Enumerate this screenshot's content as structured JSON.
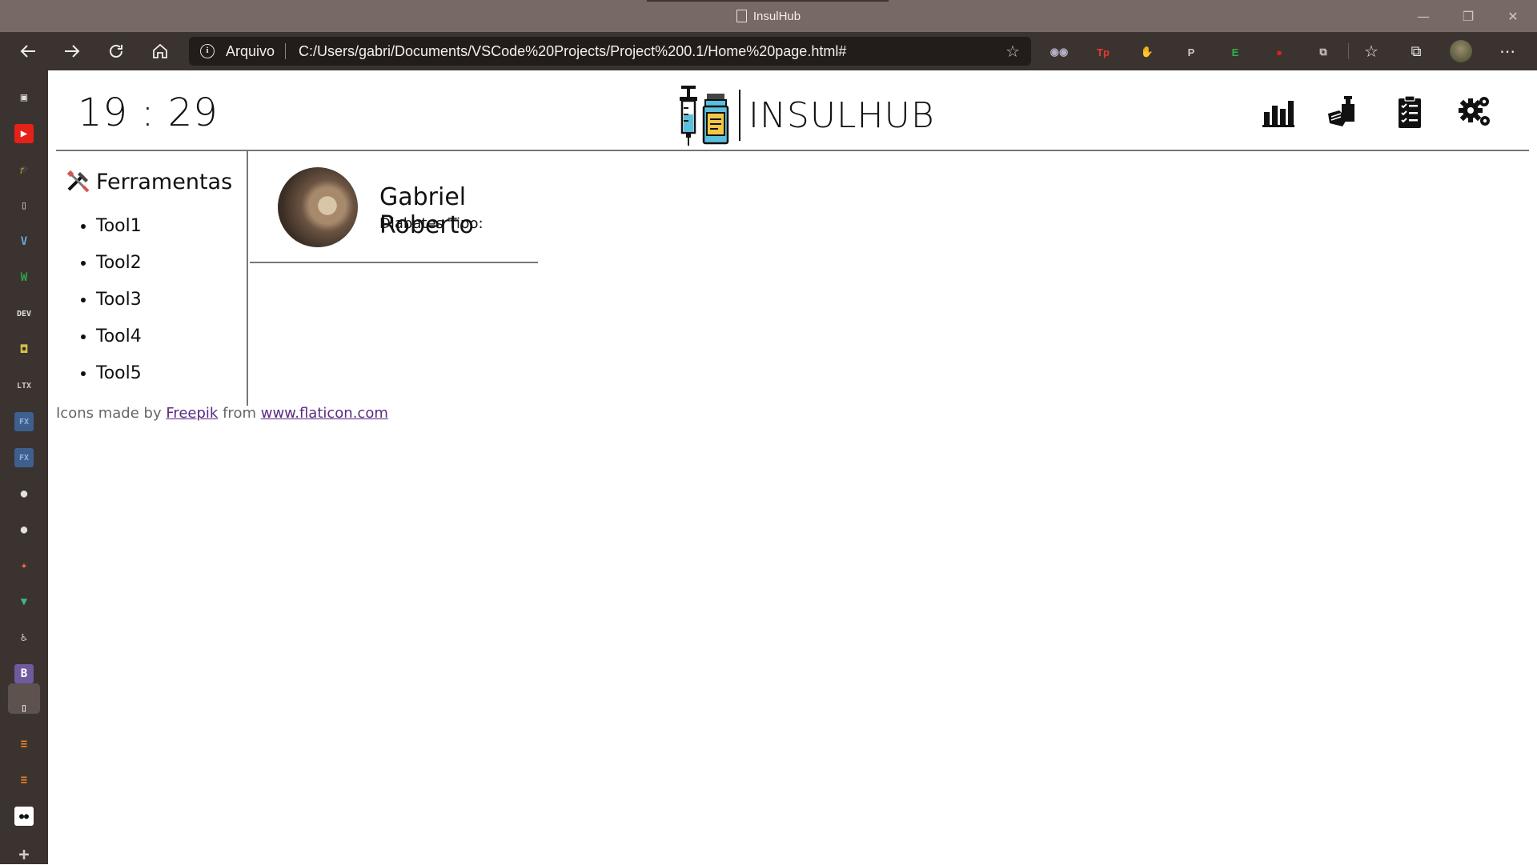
{
  "window": {
    "title": "InsulHub",
    "controls": [
      "—",
      "❐",
      "✕"
    ]
  },
  "toolbar": {
    "back_icon": "arrow-left-icon",
    "forward_icon": "arrow-right-icon",
    "refresh_icon": "refresh-icon",
    "home_icon": "home-icon",
    "address_prefix": "Arquivo",
    "url": "C:/Users/gabri/Documents/VSCode%20Projects/Project%200.1/Home%20page.html#",
    "extensions": [
      {
        "name": "ext-eyes",
        "label": "◉◉",
        "color": "#b5b0c8"
      },
      {
        "name": "ext-tp",
        "label": "Tp",
        "color": "#e53b2c"
      },
      {
        "name": "ext-hand",
        "label": "✋",
        "color": "#e0201a"
      },
      {
        "name": "ext-pinterest",
        "label": "P",
        "color": "#cfc8c5"
      },
      {
        "name": "ext-evernote",
        "label": "E",
        "color": "#2fb344"
      },
      {
        "name": "ext-record",
        "label": "●",
        "color": "#e0201a"
      },
      {
        "name": "ext-puzzle",
        "label": "⧉",
        "color": "#cfc8c5"
      }
    ]
  },
  "vertical_tabs": [
    {
      "name": "tab-actions",
      "label": "▣",
      "color": "#e6e0dd",
      "bg": "transparent"
    },
    {
      "name": "tab-youtube",
      "label": "▶",
      "color": "#ffffff",
      "bg": "#e62117"
    },
    {
      "name": "tab-school",
      "label": "🎓",
      "color": "#cfc8c5",
      "bg": "transparent"
    },
    {
      "name": "tab-file-1",
      "label": "▯",
      "color": "#cfc8c5",
      "bg": "transparent"
    },
    {
      "name": "tab-vuetify",
      "label": "V",
      "color": "#6aa4d8",
      "bg": "transparent"
    },
    {
      "name": "tab-w",
      "label": "W",
      "color": "#2fa34a",
      "bg": "transparent"
    },
    {
      "name": "tab-dev",
      "label": "DEV",
      "color": "#e6e0dd",
      "bg": "transparent"
    },
    {
      "name": "tab-yellow",
      "label": "◘",
      "color": "#d8c24a",
      "bg": "transparent"
    },
    {
      "name": "tab-ltx",
      "label": "LTX",
      "color": "#cfc8c5",
      "bg": "transparent"
    },
    {
      "name": "tab-fx-1",
      "label": "FX",
      "color": "#8fb4e0",
      "bg": "#3f5f8f"
    },
    {
      "name": "tab-fx-2",
      "label": "FX",
      "color": "#8fb4e0",
      "bg": "#3f5f8f"
    },
    {
      "name": "tab-github-1",
      "label": "●",
      "color": "#e6e0dd",
      "bg": "transparent"
    },
    {
      "name": "tab-github-2",
      "label": "●",
      "color": "#e6e0dd",
      "bg": "transparent"
    },
    {
      "name": "tab-figma",
      "label": "✦",
      "color": "#f06a4a",
      "bg": "transparent"
    },
    {
      "name": "tab-vue",
      "label": "▼",
      "color": "#41b883",
      "bg": "transparent"
    },
    {
      "name": "tab-accessibility",
      "label": "♿",
      "color": "#cfc8c5",
      "bg": "transparent"
    },
    {
      "name": "tab-bootstrap",
      "label": "B",
      "color": "#ffffff",
      "bg": "#6f5a9e"
    },
    {
      "name": "tab-file-active",
      "label": "▯",
      "color": "#ffffff",
      "bg": "transparent"
    },
    {
      "name": "tab-stackoverflow-1",
      "label": "≡",
      "color": "#f48024",
      "bg": "transparent"
    },
    {
      "name": "tab-stackoverflow-2",
      "label": "≡",
      "color": "#f48024",
      "bg": "transparent"
    },
    {
      "name": "tab-medium",
      "label": "●●",
      "color": "#111111",
      "bg": "#ffffff"
    },
    {
      "name": "tab-new",
      "label": "+",
      "color": "#cfc8c5",
      "bg": "transparent"
    }
  ],
  "header": {
    "clock": "19 : 29",
    "brand": "INSULHUB",
    "icons": [
      "chart-icon",
      "syringe-hand-icon",
      "clipboard-checklist-icon",
      "gears-icon"
    ]
  },
  "sidebar": {
    "title": "Ferramentas",
    "tools": [
      "Tool1",
      "Tool2",
      "Tool3",
      "Tool4",
      "Tool5"
    ]
  },
  "profile": {
    "name": "Gabriel Roberto",
    "diabetes_type": "Diabates Tipo:"
  },
  "footer": {
    "prefix": "Icons made by ",
    "author": "Freepik",
    "middle": " from ",
    "site": "www.flaticon.com"
  }
}
